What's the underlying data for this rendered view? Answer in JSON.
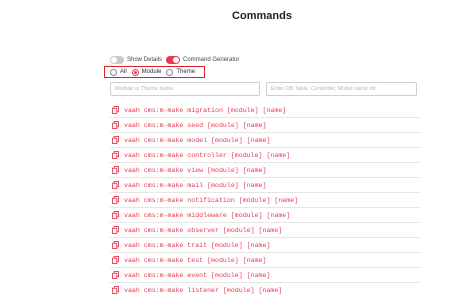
{
  "title": "Commands",
  "toggles": [
    {
      "label": "Show Details",
      "on": false
    },
    {
      "label": "Command Generator",
      "on": true
    }
  ],
  "filter": {
    "options": [
      {
        "label": "All",
        "checked": false
      },
      {
        "label": "Module",
        "checked": true
      },
      {
        "label": "Theme",
        "checked": false
      }
    ]
  },
  "inputs": {
    "module_placeholder": "Module or Theme name",
    "table_placeholder": "Enter DB Table, Controller, Model name etc"
  },
  "commands": [
    "vaah cms:m-make migration [module] [name]",
    "vaah cms:m-make seed [module] [name]",
    "vaah cms:m-make model [module] [name]",
    "vaah cms:m-make controller [module] [name]",
    "vaah cms:m-make view [module] [name]",
    "vaah cms:m-make mail [module] [name]",
    "vaah cms:m-make notification [module] [name]",
    "vaah cms:m-make middleware [module] [name]",
    "vaah cms:m-make observer [module] [name]",
    "vaah cms:m-make trait [module] [name]",
    "vaah cms:m-make test [module] [name]",
    "vaah cms:m-make event [module] [name]",
    "vaah cms:m-make listener [module] [name]"
  ],
  "colors": {
    "accent": "#e53950",
    "highlight_border": "#d9232b"
  }
}
